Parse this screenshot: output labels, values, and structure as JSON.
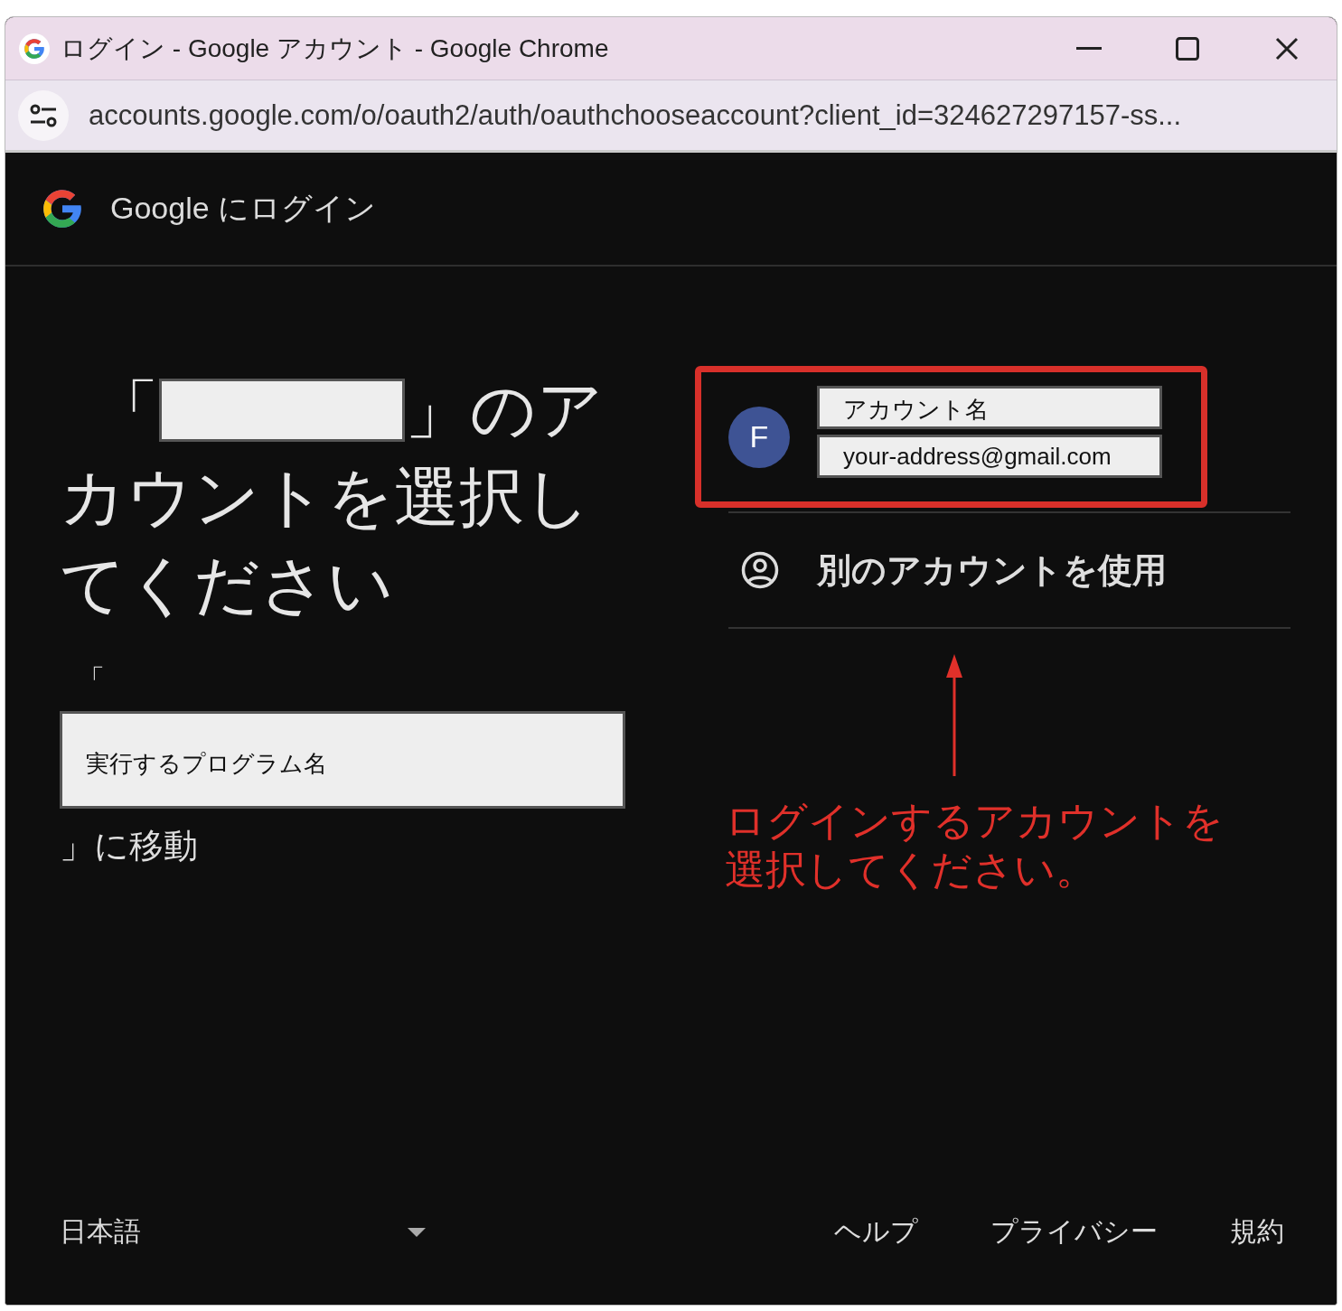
{
  "window": {
    "title": "ログイン - Google アカウント - Google Chrome"
  },
  "address_bar": {
    "url": "accounts.google.com/o/oauth2/auth/oauthchooseaccount?client_id=324627297157-ss..."
  },
  "header": {
    "title": "Google にログイン"
  },
  "heading": {
    "before": "「",
    "after": "」のア",
    "rest": "カウントを選択してください"
  },
  "continue_to": {
    "before": "「",
    "program_name": "実行するプログラム名",
    "after": "」に移動"
  },
  "account": {
    "avatar_letter": "F",
    "name": "アカウント名",
    "email": "your-address@gmail.com"
  },
  "other_account": {
    "label": "別のアカウントを使用"
  },
  "annotation": {
    "text": "ログインするアカウントを選択してください。"
  },
  "footer": {
    "language": "日本語",
    "links": [
      "ヘルプ",
      "プライバシー",
      "規約"
    ]
  }
}
